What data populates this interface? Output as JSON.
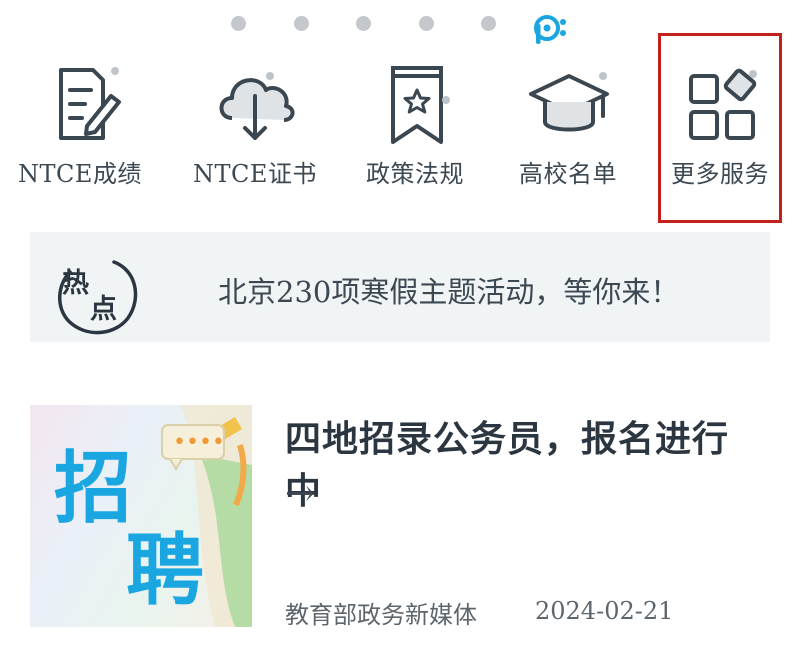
{
  "carousel": {
    "page_count": 5,
    "current_page_icon": "p-brand-icon"
  },
  "services": [
    {
      "label": "NTCE成绩",
      "icon": "score-edit-icon"
    },
    {
      "label": "NTCE证书",
      "icon": "cloud-download-icon"
    },
    {
      "label": "政策法规",
      "icon": "policy-bookmark-icon"
    },
    {
      "label": "高校名单",
      "icon": "graduation-cap-icon"
    },
    {
      "label": "更多服务",
      "icon": "grid-more-icon"
    }
  ],
  "hot": {
    "badge": "热点",
    "badge_chars": [
      "热",
      "点"
    ],
    "text": "北京230项寒假主题活动，等你来！"
  },
  "article": {
    "title": "四地招录公务员，报名进行中",
    "arrow": "→",
    "source": "教育部政务新媒体",
    "date": "2024-02-21",
    "thumb_chars": [
      "招",
      "聘"
    ],
    "thumb_dots": "••••"
  },
  "colors": {
    "highlight_border": "#c4211d",
    "accent_blue": "#1aa6e0",
    "icon_stroke": "#3a4650"
  }
}
